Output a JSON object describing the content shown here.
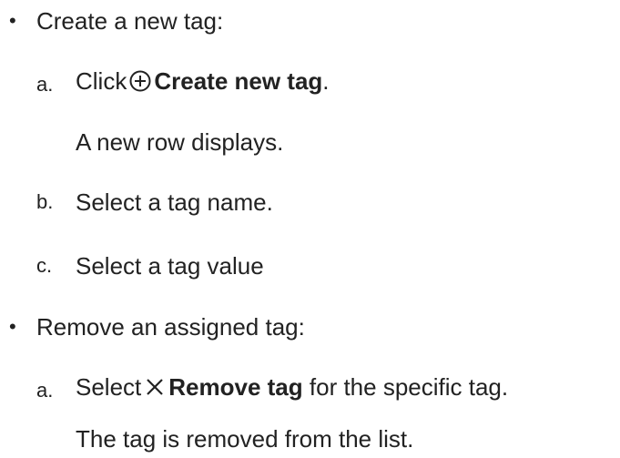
{
  "sections": [
    {
      "bullet": "•",
      "heading": "Create a new tag:",
      "steps": [
        {
          "marker": "a.",
          "pre": "Click",
          "icon": "plus-circle-icon",
          "action": "Create new tag",
          "post": ".",
          "result": "A new row displays."
        },
        {
          "marker": "b.",
          "text": "Select a tag name."
        },
        {
          "marker": "c.",
          "text": "Select a tag value"
        }
      ]
    },
    {
      "bullet": "•",
      "heading": "Remove an assigned tag:",
      "steps": [
        {
          "marker": "a.",
          "pre": "Select",
          "icon": "close-x-icon",
          "action": "Remove tag",
          "post": " for the specific tag.",
          "result": "The tag is removed from the list."
        }
      ]
    }
  ]
}
